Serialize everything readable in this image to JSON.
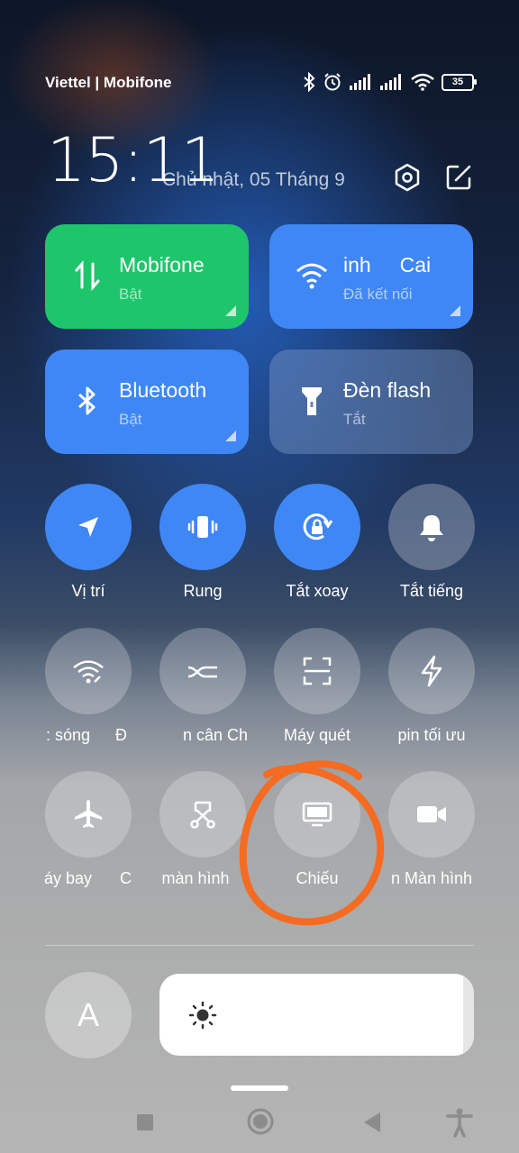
{
  "status_bar": {
    "carrier": "Viettel | Mobifone",
    "battery": "35",
    "icons": [
      "bluetooth-icon",
      "alarm-icon",
      "signal-icon",
      "signal-icon",
      "wifi-icon",
      "battery-icon"
    ]
  },
  "header": {
    "time": "15:11",
    "date": "Chủ nhật, 05 Tháng 9",
    "settings_icon": "settings-hexagon-icon",
    "edit_icon": "edit-icon"
  },
  "big_tiles": [
    {
      "title": "Mobifone",
      "subtitle": "Bật",
      "icon": "data-transfer-icon",
      "color": "#1ec66b"
    },
    {
      "title": "inh     Cai",
      "subtitle": "Đã kết nối",
      "icon": "wifi-icon",
      "color": "#3f87f5"
    },
    {
      "title": "Bluetooth",
      "subtitle": "Bật",
      "icon": "bluetooth-icon",
      "color": "#3f87f5"
    },
    {
      "title": "Đèn flash",
      "subtitle": "Tắt",
      "icon": "flashlight-icon",
      "color": "#5c78a8"
    }
  ],
  "toggles_row1": [
    {
      "label": "Vị trí",
      "icon": "location-icon",
      "state": "on"
    },
    {
      "label": "Rung",
      "icon": "vibrate-icon",
      "state": "on"
    },
    {
      "label": "Tắt xoay",
      "icon": "rotation-lock-icon",
      "state": "on"
    },
    {
      "label": "Tắt tiếng",
      "icon": "bell-icon",
      "state": "off"
    }
  ],
  "toggles_row2": [
    {
      "label": ": sóng",
      "label_right": "Đ",
      "icon": "wifi-hotspot-icon",
      "state": "off"
    },
    {
      "label": "n cân",
      "label_right": "Ch",
      "icon": "balance-icon",
      "state": "off"
    },
    {
      "label": "Máy quét",
      "icon": "scanner-icon",
      "state": "off"
    },
    {
      "label": "pin tối ưu",
      "icon": "lightning-icon",
      "state": "off"
    }
  ],
  "toggles_row3": [
    {
      "label": "áy bay",
      "label_right": "C",
      "icon": "airplane-icon",
      "state": "off"
    },
    {
      "label": "màn hình",
      "icon": "screenshot-icon",
      "state": "off"
    },
    {
      "label": "Chiếu",
      "icon": "cast-screen-icon",
      "state": "off"
    },
    {
      "label": "n Màn hình",
      "icon": "screen-record-icon",
      "state": "off"
    }
  ],
  "auto_brightness_label": "A",
  "brightness": {
    "level": 0.97,
    "icon": "sun-icon"
  },
  "nav_bar": [
    "recents-square-icon",
    "home-circle-icon",
    "back-triangle-icon",
    "accessibility-icon"
  ],
  "annotation": {
    "color": "#f46b21",
    "shape": "hand-drawn-circle"
  }
}
